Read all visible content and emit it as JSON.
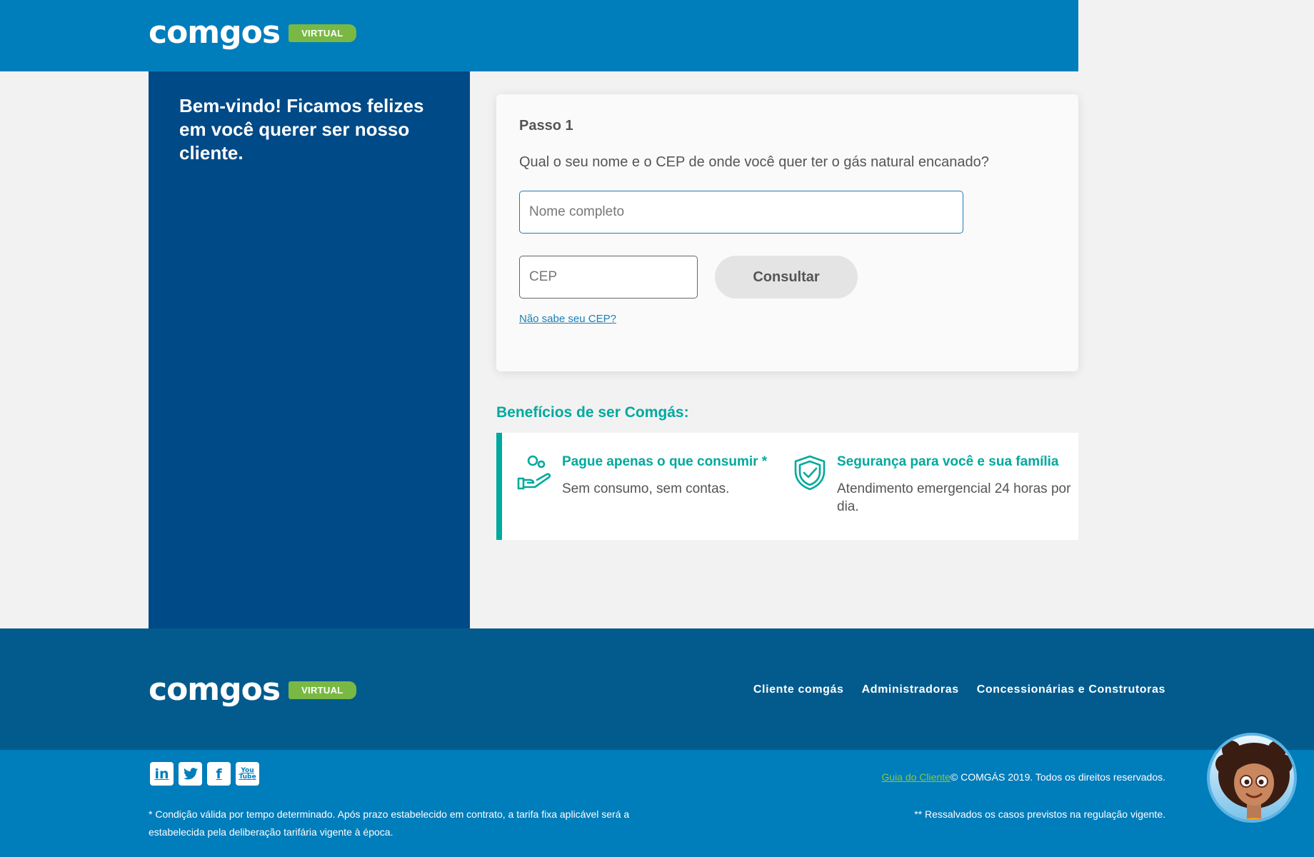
{
  "brand": {
    "name": "comgos",
    "tag": "VIRTUAL"
  },
  "sidebar": {
    "welcome": "Bem-vindo! Ficamos felizes em você querer ser nosso cliente."
  },
  "form": {
    "step": "Passo 1",
    "question": "Qual o seu nome e o CEP de onde você quer ter o gás natural encanado?",
    "name_placeholder": "Nome completo",
    "cep_placeholder": "CEP",
    "submit_label": "Consultar",
    "cep_link": "Não sabe seu CEP?"
  },
  "benefits": {
    "title": "Benefícios de ser Comgás:",
    "items": [
      {
        "icon": "hand-coin-icon",
        "title": "Pague apenas o que consumir *",
        "description": "Sem consumo, sem contas."
      },
      {
        "icon": "shield-check-icon",
        "title": "Segurança para você e sua família",
        "description": "Atendimento emergencial 24 horas por dia."
      }
    ]
  },
  "footer": {
    "nav": [
      "Cliente comgás",
      "Administradoras",
      "Concessionárias e Construtoras"
    ],
    "socials": [
      {
        "icon": "linkedin-icon",
        "glyph": "in"
      },
      {
        "icon": "twitter-icon",
        "glyph": "🐦"
      },
      {
        "icon": "facebook-icon",
        "glyph": "f"
      },
      {
        "icon": "youtube-icon",
        "glyph_top": "You",
        "glyph_bottom": "Tube"
      }
    ],
    "guide_link": "Guia do Cliente",
    "copyright": "© COMGÁS 2019. Todos os direitos reservados.",
    "disclaimer": "* Condição válida por tempo determinado. Após prazo estabelecido em contrato, a tarifa fixa aplicável será a estabelecida pela deliberação tarifária vigente à época.",
    "note": "** Ressalvados os casos previstos na regulação vigente."
  },
  "colors": {
    "primary": "#007dbb",
    "dark": "#004a87",
    "footer": "#035b8d",
    "accent": "#00a99d",
    "tag": "#7ab844"
  }
}
